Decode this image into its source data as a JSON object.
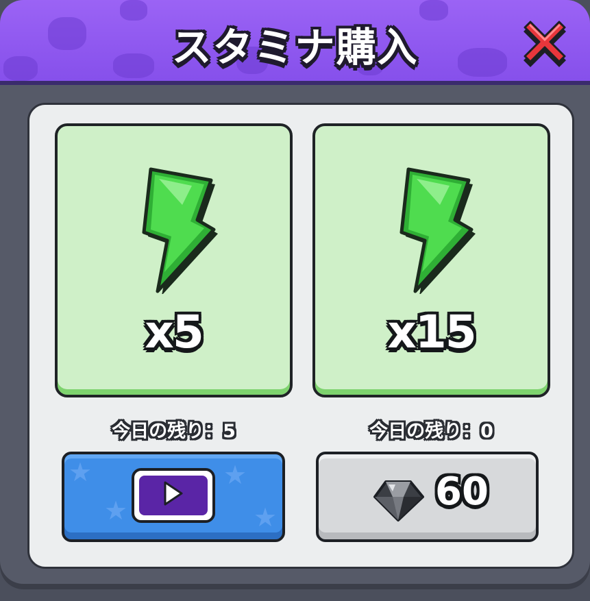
{
  "dialog": {
    "title": "スタミナ購入",
    "close_icon": "close-x-icon"
  },
  "offers": [
    {
      "icon": "stamina-bolt-icon",
      "quantity_label": "x5",
      "remaining_label": "今日の残り：5",
      "button": {
        "type": "watch-ad",
        "icon": "play-icon"
      }
    },
    {
      "icon": "stamina-bolt-icon",
      "quantity_label": "x15",
      "remaining_label": "今日の残り：0",
      "button": {
        "type": "gem-purchase",
        "icon": "gem-icon",
        "price": "60"
      }
    }
  ],
  "colors": {
    "header": "#8f59f0",
    "card": "#cff0c8",
    "ad_button": "#3f8ee8",
    "gem_button": "#d7d9db",
    "close": "#e8363b"
  }
}
